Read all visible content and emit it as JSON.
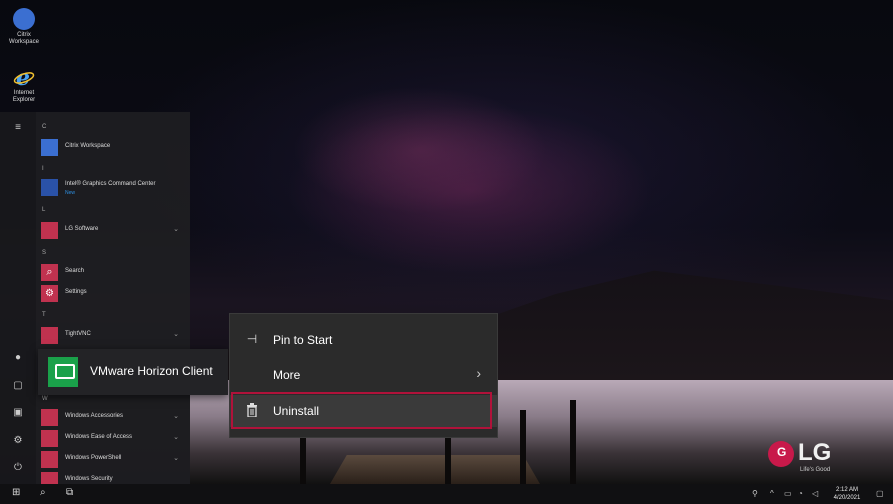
{
  "desktop": {
    "icons": [
      {
        "label": "Citrix Workspace",
        "icon": "citrix-icon"
      },
      {
        "label": "Internet Explorer",
        "icon": "internet-explorer-icon"
      }
    ]
  },
  "start_menu": {
    "groups": [
      {
        "letter": "C",
        "apps": [
          {
            "name": "Citrix Workspace"
          }
        ]
      },
      {
        "letter": "I",
        "apps": [
          {
            "name": "Intel® Graphics Command Center",
            "sub": "New"
          }
        ]
      },
      {
        "letter": "L",
        "apps": [
          {
            "name": "LG Software"
          }
        ]
      },
      {
        "letter": "S",
        "apps": [
          {
            "name": "Search"
          },
          {
            "name": "Settings"
          }
        ]
      },
      {
        "letter": "T",
        "apps": [
          {
            "name": "TightVNC"
          }
        ]
      },
      {
        "letter": "W",
        "apps": [
          {
            "name": "Windows Accessories"
          },
          {
            "name": "Windows Ease of Access"
          },
          {
            "name": "Windows PowerShell"
          },
          {
            "name": "Windows Security"
          }
        ]
      }
    ],
    "selected_app": "VMware Horizon Client"
  },
  "context_menu": {
    "items": [
      {
        "label": "Pin to Start",
        "icon": "pin-icon"
      },
      {
        "label": "More",
        "icon": "",
        "has_submenu": true
      },
      {
        "label": "Uninstall",
        "icon": "trash-icon",
        "highlighted": true
      }
    ]
  },
  "branding": {
    "logo": "LG",
    "tagline": "Life's Good"
  },
  "taskbar": {
    "time": "2:12 AM",
    "date": "4/20/2021"
  },
  "colors": {
    "highlight": "#b0123a",
    "app_tile": "#c0324f",
    "vmware_tile": "#1aa14a"
  }
}
